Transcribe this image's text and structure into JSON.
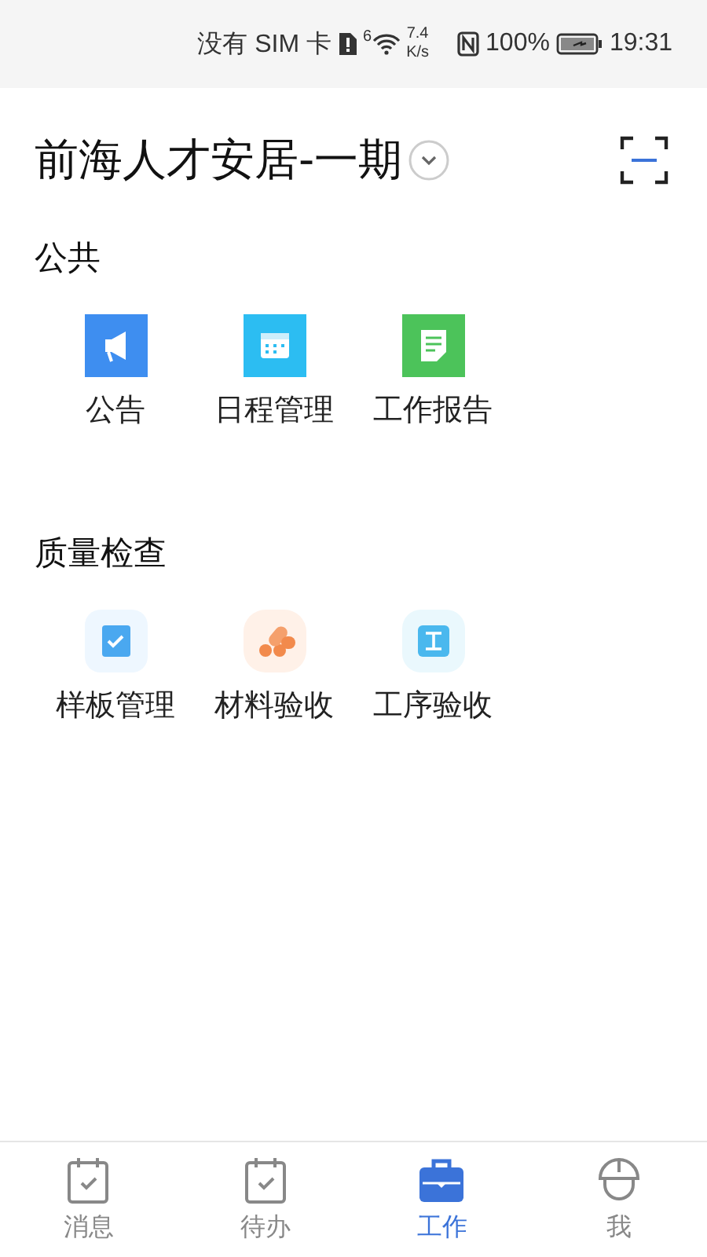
{
  "status_bar": {
    "carrier": "没有 SIM 卡",
    "wifi_label": "6",
    "speed_value": "7.4",
    "speed_unit": "K/s",
    "battery": "100%",
    "time": "19:31"
  },
  "header": {
    "title": "前海人才安居-一期"
  },
  "sections": [
    {
      "title": "公共",
      "items": [
        {
          "label": "公告",
          "kind": "megaphone"
        },
        {
          "label": "日程管理",
          "kind": "calendar"
        },
        {
          "label": "工作报告",
          "kind": "report"
        }
      ]
    },
    {
      "title": "质量检查",
      "items": [
        {
          "label": "样板管理",
          "kind": "check"
        },
        {
          "label": "材料验收",
          "kind": "material"
        },
        {
          "label": "工序验收",
          "kind": "process"
        }
      ]
    }
  ],
  "tabs": [
    {
      "label": "消息",
      "kind": "task",
      "selected": false
    },
    {
      "label": "待办",
      "kind": "task",
      "selected": false
    },
    {
      "label": "工作",
      "kind": "briefcase",
      "selected": true
    },
    {
      "label": "我",
      "kind": "helmet",
      "selected": false
    }
  ]
}
